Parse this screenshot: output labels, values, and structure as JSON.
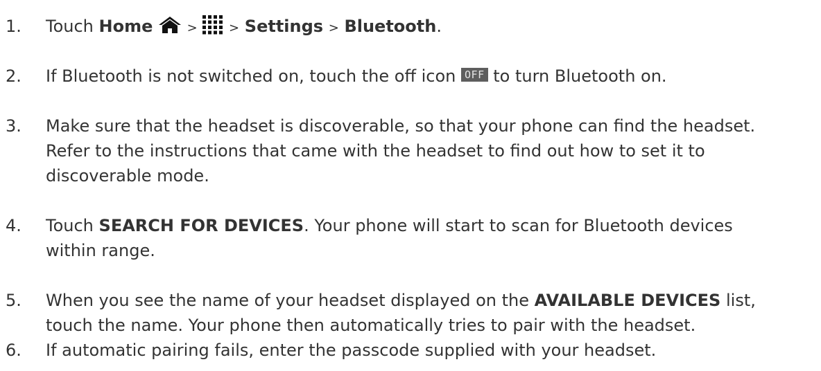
{
  "steps": [
    {
      "num": "1.",
      "touch": "Touch",
      "home": "Home",
      "gt1": ">",
      "gt2": ">",
      "settings": "Settings",
      "gt3": ">",
      "bluetooth": "Bluetooth",
      "end": "."
    },
    {
      "num": "2.",
      "before": "If Bluetooth is not switched on, touch the off icon",
      "off_icon": "OFF",
      "after": "to turn Bluetooth on."
    },
    {
      "num": "3.",
      "line1": "Make sure that the headset is discoverable, so that your phone can find the headset.",
      "line2": "Refer to the instructions that came with the headset to find out how to set it to",
      "line3": "discoverable mode."
    },
    {
      "num": "4.",
      "touch": "Touch",
      "search": "SEARCH FOR DEVICES",
      "rest1": ". Your phone will start to scan for Bluetooth devices",
      "line2": "within range."
    },
    {
      "num": "5.",
      "before": "When you see the name of your headset displayed on the",
      "available": "AVAILABLE DEVICES",
      "after": "list,",
      "line2": "touch the name. Your phone then automatically tries to pair with the headset."
    },
    {
      "num": "6.",
      "line1": "If automatic pairing fails, enter the passcode supplied with your headset."
    }
  ],
  "icons": {
    "home": "home-icon",
    "apps": "apps-grid-icon",
    "off_color": "#5e5e5e"
  }
}
